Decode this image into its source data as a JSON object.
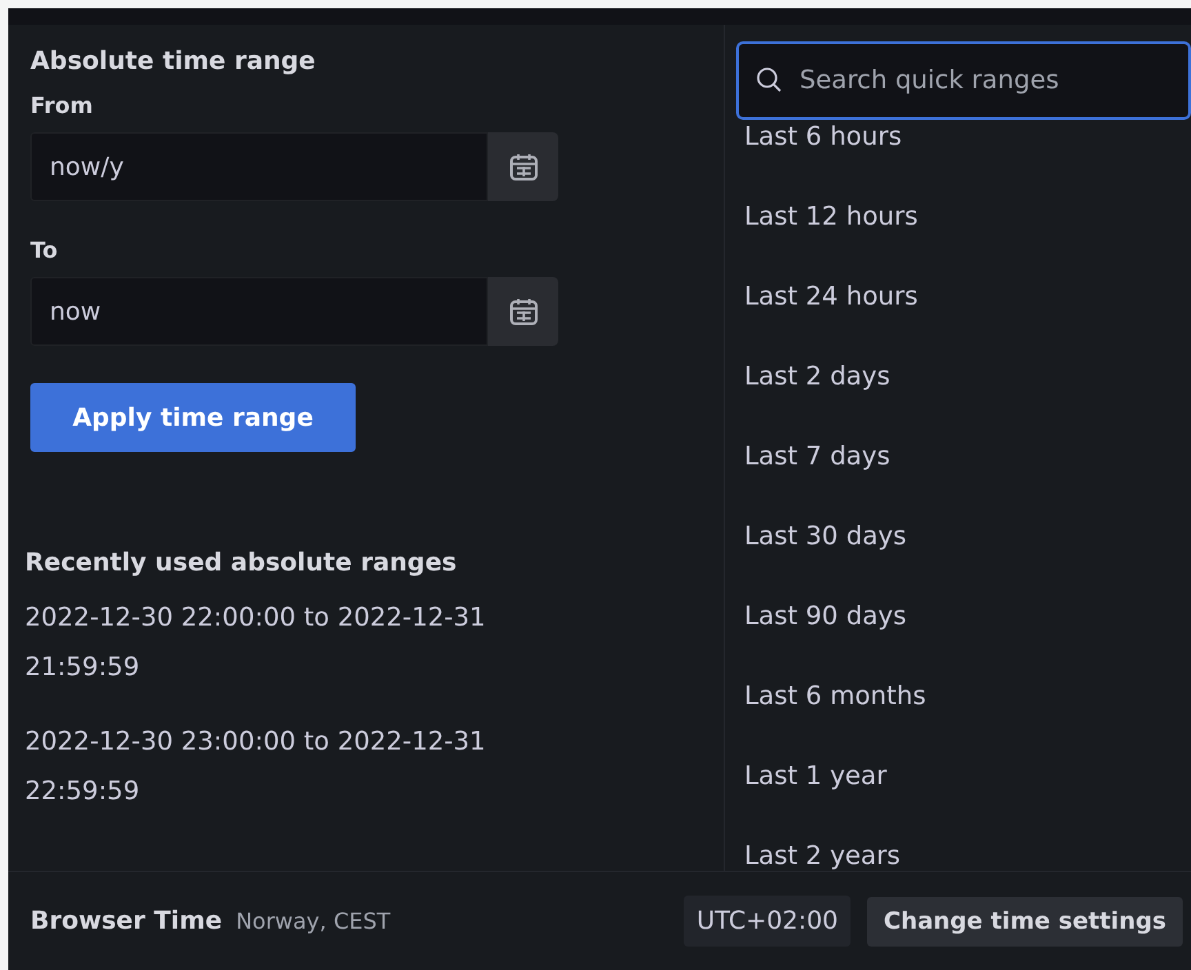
{
  "absolute_range": {
    "title": "Absolute time range",
    "from": {
      "label": "From",
      "value": "now/y"
    },
    "to": {
      "label": "To",
      "value": "now"
    },
    "apply_button": "Apply time range"
  },
  "recent": {
    "title": "Recently used absolute ranges",
    "items": [
      "2022-12-30 22:00:00 to 2022-12-31 21:59:59",
      "2022-12-30 23:00:00 to 2022-12-31 22:59:59"
    ]
  },
  "quick_ranges": {
    "search": {
      "placeholder": "Search quick ranges"
    },
    "items": [
      "Last 6 hours",
      "Last 12 hours",
      "Last 24 hours",
      "Last 2 days",
      "Last 7 days",
      "Last 30 days",
      "Last 90 days",
      "Last 6 months",
      "Last 1 year",
      "Last 2 years"
    ]
  },
  "footer": {
    "label": "Browser Time",
    "location": "Norway, CEST",
    "offset": "UTC+02:00",
    "change_button": "Change time settings"
  }
}
